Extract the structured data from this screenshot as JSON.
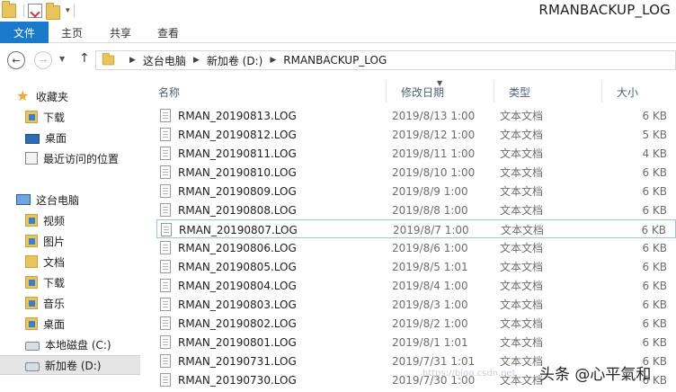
{
  "window": {
    "title": "RMANBACKUP_LOG"
  },
  "ribbon": {
    "file_tab": "文件",
    "tabs": [
      "主页",
      "共享",
      "查看"
    ],
    "file_tab_color": "#1979ca"
  },
  "address": {
    "crumbs": [
      "这台电脑",
      "新加卷 (D:)",
      "RMANBACKUP_LOG"
    ]
  },
  "nav": {
    "favorites_label": "收藏夹",
    "favorites": [
      "下载",
      "桌面",
      "最近访问的位置"
    ],
    "pc_label": "这台电脑",
    "pc_items": [
      "视频",
      "图片",
      "文档",
      "下载",
      "音乐",
      "桌面",
      "本地磁盘 (C:)",
      "新加卷 (D:)"
    ],
    "selected": "新加卷 (D:)"
  },
  "list": {
    "columns": [
      "名称",
      "修改日期",
      "类型",
      "大小"
    ],
    "sort_column": "修改日期",
    "selected_row": 6,
    "rows": [
      {
        "name": "RMAN_20190813.LOG",
        "date": "2019/8/13 1:00",
        "type": "文本文档",
        "size": "6 KB"
      },
      {
        "name": "RMAN_20190812.LOG",
        "date": "2019/8/12 1:00",
        "type": "文本文档",
        "size": "5 KB"
      },
      {
        "name": "RMAN_20190811.LOG",
        "date": "2019/8/11 1:00",
        "type": "文本文档",
        "size": "4 KB"
      },
      {
        "name": "RMAN_20190810.LOG",
        "date": "2019/8/10 1:00",
        "type": "文本文档",
        "size": "6 KB"
      },
      {
        "name": "RMAN_20190809.LOG",
        "date": "2019/8/9 1:00",
        "type": "文本文档",
        "size": "6 KB"
      },
      {
        "name": "RMAN_20190808.LOG",
        "date": "2019/8/8 1:00",
        "type": "文本文档",
        "size": "6 KB"
      },
      {
        "name": "RMAN_20190807.LOG",
        "date": "2019/8/7 1:00",
        "type": "文本文档",
        "size": "6 KB"
      },
      {
        "name": "RMAN_20190806.LOG",
        "date": "2019/8/6 1:00",
        "type": "文本文档",
        "size": "6 KB"
      },
      {
        "name": "RMAN_20190805.LOG",
        "date": "2019/8/5 1:01",
        "type": "文本文档",
        "size": "6 KB"
      },
      {
        "name": "RMAN_20190804.LOG",
        "date": "2019/8/4 1:00",
        "type": "文本文档",
        "size": "6 KB"
      },
      {
        "name": "RMAN_20190803.LOG",
        "date": "2019/8/3 1:00",
        "type": "文本文档",
        "size": "6 KB"
      },
      {
        "name": "RMAN_20190802.LOG",
        "date": "2019/8/2 1:00",
        "type": "文本文档",
        "size": "6 KB"
      },
      {
        "name": "RMAN_20190801.LOG",
        "date": "2019/8/1 1:01",
        "type": "文本文档",
        "size": "6 KB"
      },
      {
        "name": "RMAN_20190731.LOG",
        "date": "2019/7/31 1:01",
        "type": "文本文档",
        "size": "6 KB"
      },
      {
        "name": "RMAN_20190730.LOG",
        "date": "2019/7/30 1:00",
        "type": "文本文档",
        "size": "6 KB"
      }
    ]
  },
  "watermark": {
    "text": "头条 @心平氣和"
  }
}
